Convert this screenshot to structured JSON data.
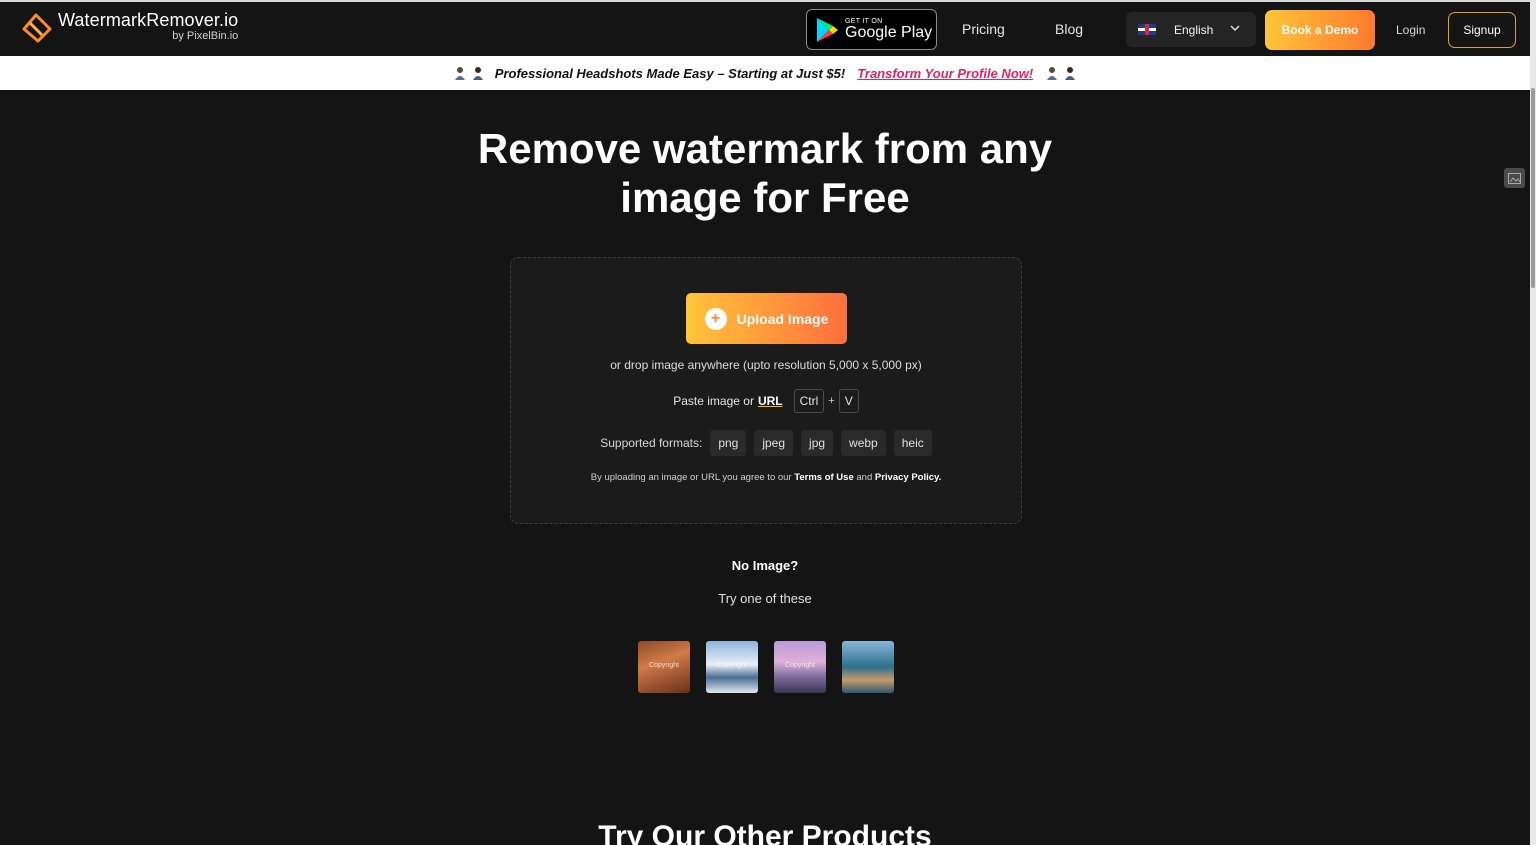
{
  "header": {
    "logo_title": "WatermarkRemover.io",
    "logo_sub": "by PixelBin.io",
    "gplay_small": "GET IT ON",
    "gplay_big": "Google Play",
    "nav": [
      {
        "label": "Pricing"
      },
      {
        "label": "Blog"
      }
    ],
    "language": "English",
    "book_demo": "Book a Demo",
    "login": "Login",
    "signup": "Signup"
  },
  "promo": {
    "text": "Professional Headshots Made Easy – Starting at Just $5!",
    "link": "Transform Your Profile Now!"
  },
  "hero": {
    "title_line1": "Remove watermark from any",
    "title_line2": "image for Free"
  },
  "upload": {
    "button": "Upload Image",
    "drop_text": "or drop image anywhere (upto resolution 5,000 x 5,000 px)",
    "paste_text": "Paste image or",
    "url_label": "URL",
    "key_ctrl": "Ctrl",
    "key_plus": "+",
    "key_v": "V",
    "formats_label": "Supported formats:",
    "formats": [
      "png",
      "jpeg",
      "jpg",
      "webp",
      "heic"
    ],
    "terms_prefix": "By uploading an image or URL you agree to our",
    "terms_link": "Terms of Use",
    "terms_and": "and",
    "privacy_link": "Privacy Policy."
  },
  "samples": {
    "heading": "No Image?",
    "subheading": "Try one of these",
    "watermark_texts": [
      "Copyright",
      "Copyright",
      "Copyright",
      ""
    ]
  },
  "footer_heading": "Try Our Other Products",
  "colors": {
    "background": "#141414",
    "accent_start": "#ffc53a",
    "accent_end": "#ff6f3d",
    "promo_link": "#e0245e"
  }
}
